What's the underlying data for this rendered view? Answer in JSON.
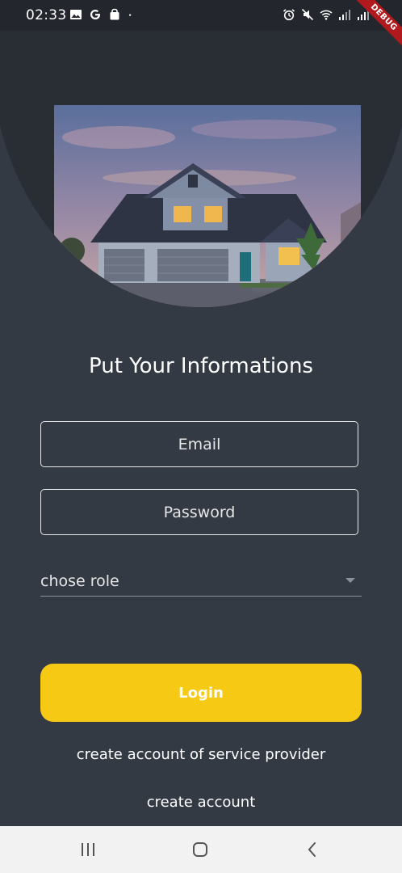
{
  "status_bar": {
    "time": "02:33",
    "debug_label": "DEBUG",
    "icons_left": [
      "gallery-icon",
      "google-icon",
      "bag-icon",
      "dot-icon"
    ],
    "icons_right": [
      "alarm-icon",
      "mute-icon",
      "wifi-icon",
      "signal-icon",
      "signal-icon"
    ]
  },
  "hero": {
    "image": "house-photo"
  },
  "form": {
    "title": "Put Your Informations",
    "email_placeholder": "Email",
    "password_placeholder": "Password",
    "role_select_text": "chose role",
    "login_label": "Login"
  },
  "links": {
    "provider": "create account of service provider",
    "account": "create account"
  },
  "colors": {
    "background": "#343a44",
    "accent": "#f5c914",
    "circle": "#292e35",
    "nav_bar": "#f2f2f2"
  },
  "nav_bar": {
    "buttons": [
      "recents-icon",
      "home-icon",
      "back-icon"
    ]
  }
}
